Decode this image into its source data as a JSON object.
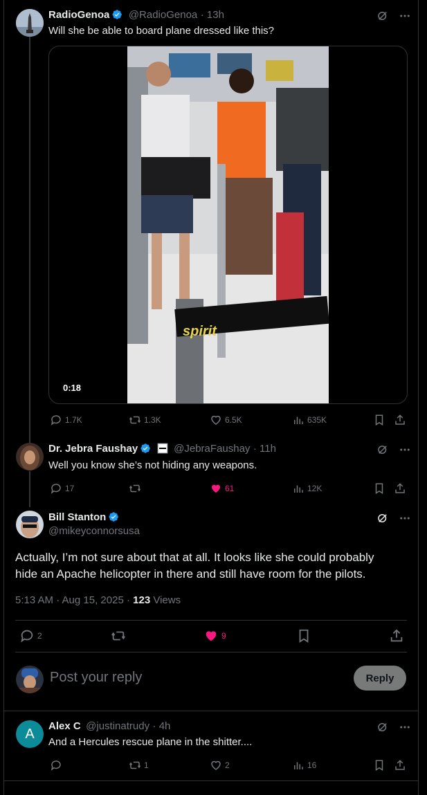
{
  "post1": {
    "name": "RadioGenoa",
    "handle": "@RadioGenoa",
    "time": "13h",
    "text": "Will she be able to board plane dressed like this?",
    "video_duration": "0:18",
    "video_brand_text": "spirit",
    "replies": "1.7K",
    "reposts": "1.3K",
    "likes": "6.5K",
    "views": "635K"
  },
  "post2": {
    "name": "Dr. Jebra Faushay",
    "handle": "@JebraFaushay",
    "time": "11h",
    "text": "Well you know she’s not hiding any weapons.",
    "replies": "17",
    "reposts": "",
    "likes": "61",
    "views": "12K"
  },
  "main_post": {
    "name": "Bill Stanton",
    "handle": "@mikeyconnorsusa",
    "text_line1": "Actually, I’m not sure about that at all. It looks like she could probably",
    "text_line2": "hide an Apache helicopter in there and still have room for the pilots.",
    "timestamp": "5:13 AM · Aug 15, 2025",
    "views_count": "123",
    "views_label": "Views",
    "replies": "2",
    "likes": "9"
  },
  "composer": {
    "placeholder": "Post your reply",
    "reply_button": "Reply"
  },
  "post3": {
    "name": "Alex C",
    "avatar_letter": "A",
    "handle": "@justinatrudy",
    "time": "4h",
    "text": "And a Hercules rescue plane in the shitter....",
    "reposts": "1",
    "likes": "2",
    "views": "16"
  },
  "colors": {
    "background": "#000000",
    "text": "#e7e9ea",
    "muted": "#71767b",
    "verified": "#1d9bf0",
    "like": "#f91880",
    "border": "#2f3336"
  }
}
